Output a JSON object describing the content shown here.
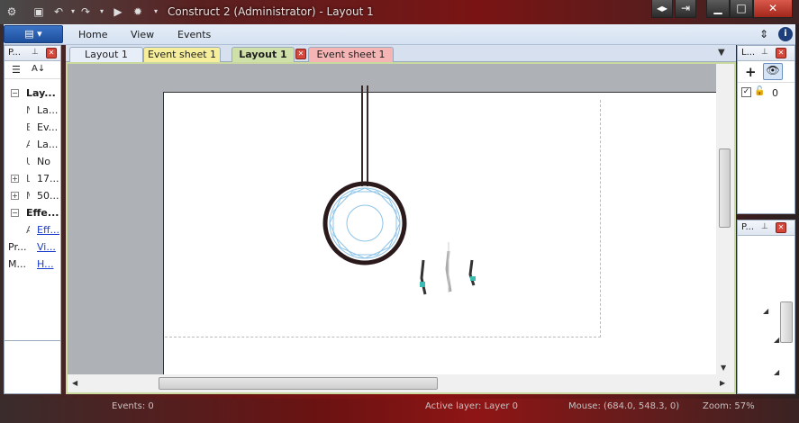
{
  "window": {
    "title": "Construct 2 (Administrator) - Layout 1"
  },
  "ribbon": {
    "tabs": [
      "Home",
      "View",
      "Events"
    ]
  },
  "document_tabs": [
    {
      "label": "Layout 1",
      "color": "#e8eef8"
    },
    {
      "label": "Event sheet 1",
      "color": "#f6ee9a"
    },
    {
      "label": "Layout 1",
      "color": "#cfe0a8",
      "active": true
    },
    {
      "label": "Event sheet 1",
      "color": "#f5b5b5"
    }
  ],
  "properties_panel": {
    "title": "P...",
    "rows": [
      {
        "label": "Lay...",
        "bold": true,
        "expander": "minus"
      },
      {
        "label": "La..."
      },
      {
        "label": "Ev..."
      },
      {
        "label": "La..."
      },
      {
        "label": "No"
      },
      {
        "label": "17...",
        "expander": "plus"
      },
      {
        "label": "50...",
        "expander": "plus"
      },
      {
        "label": "Effe...",
        "bold": true,
        "expander": "minus"
      },
      {
        "label": "Eff...",
        "link": true
      },
      {
        "label": "Pr...",
        "value": "Vi...",
        "link": true
      },
      {
        "label": "M...",
        "value": "H...",
        "link": true
      }
    ]
  },
  "layers_panel": {
    "title": "L...",
    "layers": [
      {
        "name": "0",
        "visible": true
      }
    ]
  },
  "projects_panel": {
    "title": "P..."
  },
  "status_bar": {
    "events": "Events: 0",
    "active_layer": "Active layer: Layer 0",
    "mouse": "Mouse: (684.0, 548.3, 0)",
    "zoom": "Zoom: 57%"
  }
}
